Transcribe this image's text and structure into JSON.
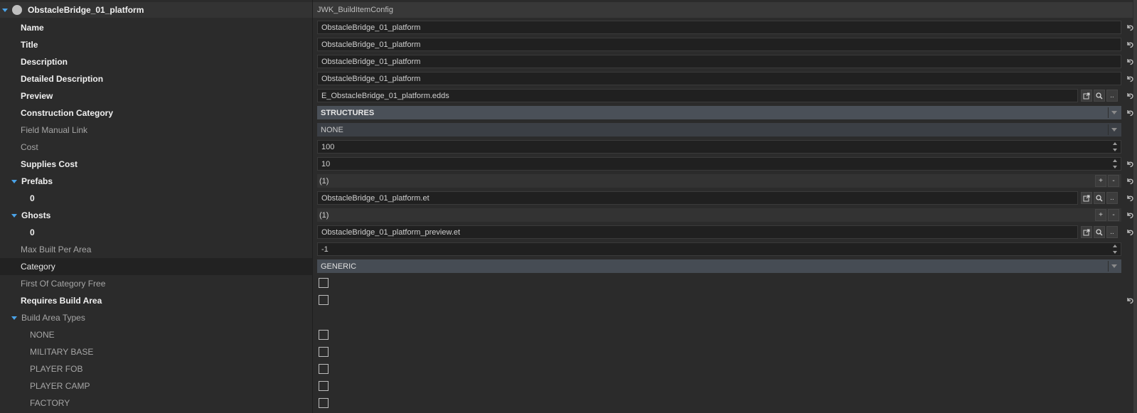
{
  "header": {
    "title": "ObstacleBridge_01_platform",
    "class_name": "JWK_BuildItemConfig"
  },
  "labels": {
    "name": "Name",
    "title": "Title",
    "description": "Description",
    "detailed_description": "Detailed Description",
    "preview": "Preview",
    "construction_category": "Construction Category",
    "field_manual_link": "Field Manual Link",
    "cost": "Cost",
    "supplies_cost": "Supplies Cost",
    "prefabs": "Prefabs",
    "prefabs_index": "0",
    "ghosts": "Ghosts",
    "ghosts_index": "0",
    "max_built_per_area": "Max Built Per Area",
    "category": "Category",
    "first_of_category_free": "First Of Category Free",
    "requires_build_area": "Requires Build Area",
    "build_area_types": "Build Area Types",
    "bat_none": "NONE",
    "bat_military_base": "MILITARY BASE",
    "bat_player_fob": "PLAYER FOB",
    "bat_player_camp": "PLAYER CAMP",
    "bat_factory": "FACTORY"
  },
  "values": {
    "name": "ObstacleBridge_01_platform",
    "title": "ObstacleBridge_01_platform",
    "description": "ObstacleBridge_01_platform",
    "detailed_description": "ObstacleBridge_01_platform",
    "preview": "E_ObstacleBridge_01_platform.edds",
    "construction_category": "STRUCTURES",
    "field_manual_link": "NONE",
    "cost": "100",
    "supplies_cost": "10",
    "prefabs_count": "(1)",
    "prefabs_0": "ObstacleBridge_01_platform.et",
    "ghosts_count": "(1)",
    "ghosts_0": "ObstacleBridge_01_platform_preview.et",
    "max_built_per_area": "-1",
    "category": "GENERIC",
    "first_of_category_free": false,
    "requires_build_area": false,
    "bat_none": false,
    "bat_military_base": false,
    "bat_player_fob": false,
    "bat_player_camp": false,
    "bat_factory": false
  },
  "buttons": {
    "add": "+",
    "remove": "-",
    "browse": ".."
  },
  "icons": {
    "expand": "triangle-down-icon",
    "entity": "circle-icon",
    "open": "open-external-icon",
    "search": "magnifier-icon",
    "reset": "undo-icon"
  },
  "colors": {
    "background": "#2b2b2b",
    "accent": "#4aa3e8",
    "field_bg": "#202020"
  }
}
